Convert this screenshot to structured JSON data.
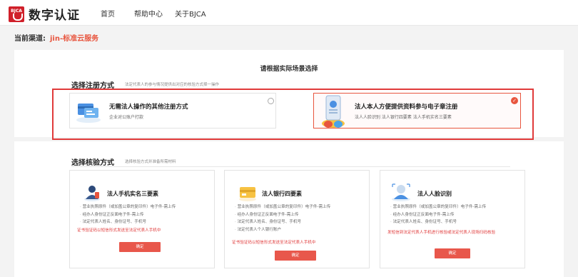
{
  "header": {
    "logo_badge": "BJCA",
    "logo_text": "数字认证",
    "nav": [
      "首页",
      "帮助中心",
      "关于BJCA"
    ]
  },
  "channel": {
    "label": "当前渠道:",
    "value": "jin-标准云服务"
  },
  "page_title": "请根据实际场景选择",
  "register": {
    "title": "选择注册方式",
    "subtitle": "法定代表人的参与情况提供出对应的核验方式择一操作",
    "options": [
      {
        "title": "无需法人操作的其他注册方式",
        "desc": "企业对公账户打款",
        "selected": false
      },
      {
        "title": "法人本人方便提供资料参与电子章注册",
        "desc": "法人人脸识别  法人银行四要素  法人手机实名三要素",
        "selected": true
      }
    ]
  },
  "verify": {
    "title": "选择核验方式",
    "subtitle": "选择核验方式并准备所需材料",
    "cards": [
      {
        "title": "法人手机实名三要素",
        "items": [
          "营业执照原件（或加盖公章的复印件）电子件-需上传",
          "经办人身份证正反面电子件-需上传",
          "法定代表人姓名、身份证号、手机号"
        ],
        "note": "证书验证码以短信形式发送至法定代表人手机中",
        "button": "确定"
      },
      {
        "title": "法人银行四要素",
        "items": [
          "营业执照原件（或加盖公章的复印件）电子件-需上传",
          "经办人身份证正反面电子件-需上传",
          "法定代表人姓名、身份证号、手机号",
          "法定代表人个人银行账户"
        ],
        "note": "证书验证码以短信形式发送至法定代表人手机中",
        "button": "确定"
      },
      {
        "title": "法人人脸识别",
        "items": [
          "营业执照原件（或加盖公章的复印件）电子件-需上传",
          "经办人身份证正反面电子件-需上传",
          "法定代表人姓名、身份证号、手机号"
        ],
        "note": "发短信到法定代表人手机进行核验或法定代表人现场扫码核验",
        "button": "确定"
      }
    ]
  },
  "colors": {
    "accent": "#e8553e",
    "highlight": "#e03a3a",
    "button": "#e8574b"
  }
}
